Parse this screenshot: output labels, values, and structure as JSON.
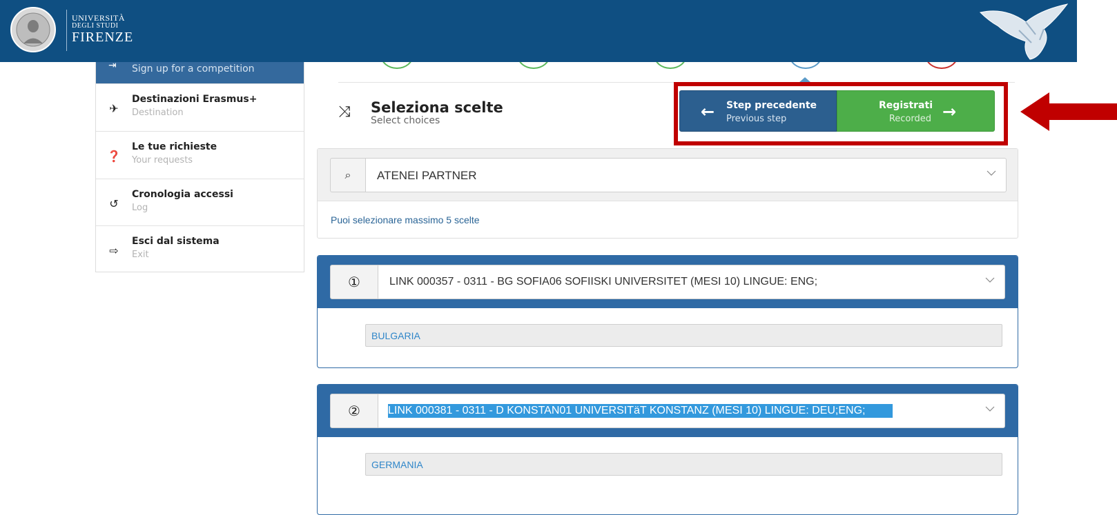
{
  "header": {
    "logo_line1": "UNIVERSITÀ",
    "logo_line2": "DEGLI STUDI",
    "logo_line3": "FIRENZE",
    "background": "#0f4f82"
  },
  "sidebar": {
    "active_sub": "Sign up for a competition",
    "items": [
      {
        "icon": "plane-icon",
        "title": "Destinazioni Erasmus+",
        "sub": "Destination"
      },
      {
        "icon": "question-icon",
        "title": "Le tue richieste",
        "sub": "Your requests"
      },
      {
        "icon": "history-icon",
        "title": "Cronologia accessi",
        "sub": "Log"
      },
      {
        "icon": "sign-out-icon",
        "title": "Esci dal sistema",
        "sub": "Exit"
      }
    ]
  },
  "section": {
    "icon": "random-icon",
    "title": "Seleziona scelte",
    "subtitle": "Select choices"
  },
  "buttons": {
    "prev_title": "Step precedente",
    "prev_sub": "Previous step",
    "next_title": "Registrati",
    "next_sub": "Recorded"
  },
  "partner": {
    "select_value": "ATENEI PARTNER",
    "note": "Puoi selezionare massimo 5 scelte"
  },
  "choices": [
    {
      "number": "①",
      "value": "LINK 000357 - 0311 - BG SOFIA06 SOFIISKI UNIVERSITET (MESI 10) LINGUE: ENG;",
      "country": "BULGARIA"
    },
    {
      "number": "②",
      "value": "LINK 000381 - 0311 - D KONSTAN01 UNIVERSITäT KONSTANZ (MESI 10) LINGUE: DEU;ENG;",
      "country": "GERMANIA"
    }
  ],
  "colors": {
    "primary": "#2f6aa5",
    "success": "#4dae49",
    "highlight": "#c00000",
    "stepper_green": "#5cb85c",
    "stepper_blue": "#5b9bc8",
    "stepper_red": "#c9302c"
  }
}
